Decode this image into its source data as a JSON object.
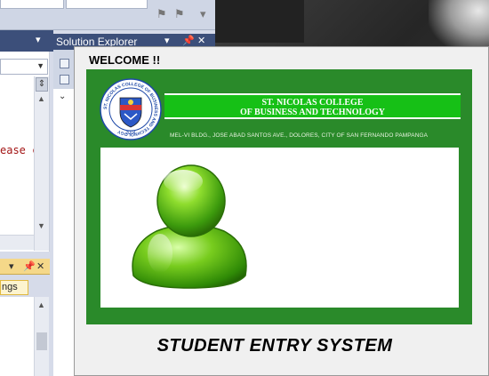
{
  "ide": {
    "solution_explorer": {
      "title": "Solution Explorer",
      "pin_glyph": "ᵖ",
      "close_glyph": "✕",
      "dropdown_glyph": "▾",
      "expand_glyph": "⌄"
    },
    "editor": {
      "code_fragment": "ease c",
      "split_glyph": "⇕"
    },
    "output_panel": {
      "tab_label": "ngs",
      "pin_glyph": "ᵖ",
      "close_glyph": "✕",
      "dropdown_glyph": "▾"
    }
  },
  "welcome_window": {
    "title": "WELCOME !!",
    "banner": {
      "college_line1": "ST. NICOLAS COLLEGE",
      "college_line2": "OF BUSINESS AND TECHNOLOGY",
      "address": "MEL-VI BLDG., JOSE ABAD SANTOS AVE., DOLORES, CITY OF SAN FERNANDO PAMPANGA",
      "seal_ring_text": "ST. NICOLAS COLLEGE OF BUSINESS AND TECHNOLOGY",
      "seal_year": "2004"
    },
    "illustration": "user-avatar-icon",
    "system_title": "STUDENT ENTRY SYSTEM"
  },
  "colors": {
    "panel_green": "#2a8a2a",
    "band_green": "#16c016",
    "ide_blue": "#3c4f7a",
    "window_bg": "#f0f0f0"
  }
}
